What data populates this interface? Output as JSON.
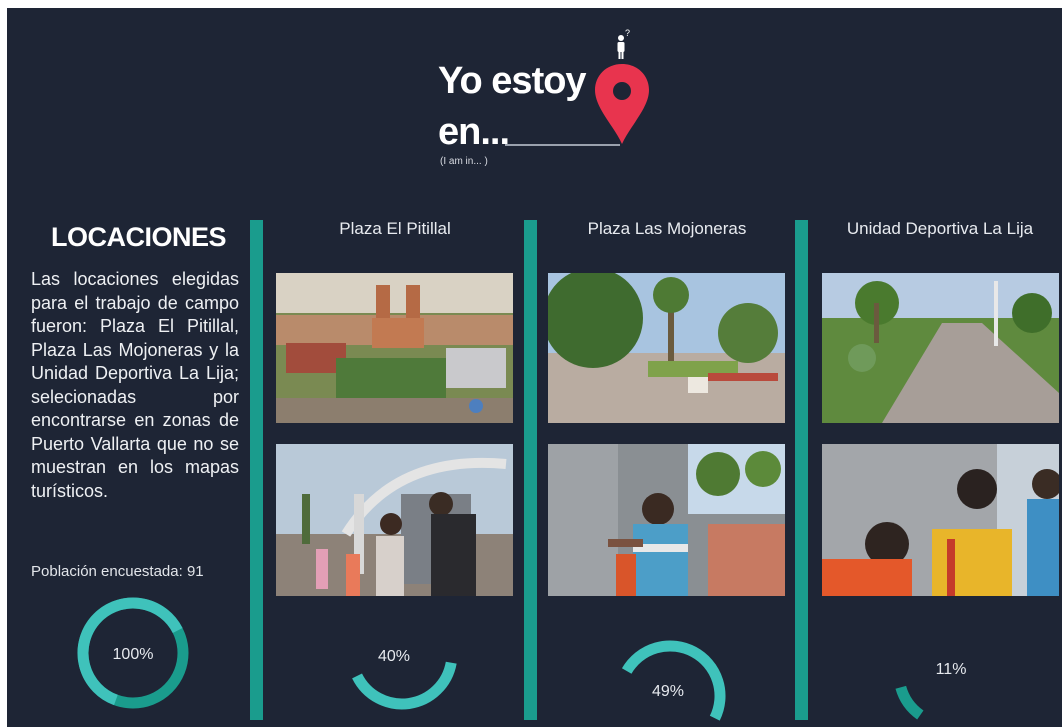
{
  "header": {
    "title_line1": "Yo estoy",
    "title_line2": "en...",
    "subtitle": "(I am in... )"
  },
  "locations": {
    "heading": "LOCACIONES",
    "description": "Las locaciones elegidas para el trabajo de campo fueron: Plaza El Pitillal, Plaza Las Mojoneras y la Unidad Deportiva La Lija; selecionadas por encontrarse en zonas de Puerto Vallarta que no se muestran en los mapas turísticos.",
    "population": "Población encuestada: 91",
    "total_percent": "100%",
    "total_fraction": 1.0
  },
  "columns": [
    {
      "title": "Plaza El Pitillal",
      "percent_label": "40%",
      "fraction": 0.4
    },
    {
      "title": "Plaza Las Mojoneras",
      "percent_label": "49%",
      "fraction": 0.49
    },
    {
      "title": "Unidad Deportiva La Lija",
      "percent_label": "11%",
      "fraction": 0.11
    }
  ],
  "colors": {
    "background": "#1e2535",
    "accent_teal": "#1a9c8d",
    "ring_light": "#3fc2bb",
    "pin_red": "#e8344e"
  },
  "icons": [
    "map-pin-icon",
    "person-question-icon"
  ]
}
